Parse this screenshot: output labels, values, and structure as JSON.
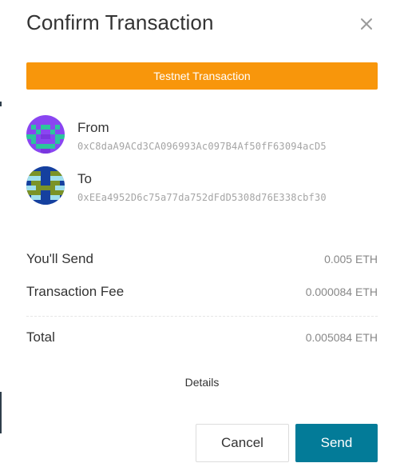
{
  "dialog": {
    "title": "Confirm Transaction",
    "close_icon": "close-icon"
  },
  "banner": {
    "text": "Testnet Transaction",
    "color": "#f8960b"
  },
  "from": {
    "label": "From",
    "address": "0xC8daA9ACd3CA096993Ac097B4Af50fF63094acD5",
    "avatar_icon": "identicon-avatar",
    "avatar_colors": [
      "#8a45f1",
      "#2bc69c"
    ]
  },
  "to": {
    "label": "To",
    "address": "0xEEa4952D6c75a77da752dFdD5308d76E338cbf30",
    "avatar_icon": "identicon-avatar",
    "avatar_colors": [
      "#15409f",
      "#7b9327",
      "#9fe0ee"
    ]
  },
  "summary": {
    "send_label": "You'll Send",
    "send_value": "0.005 ETH",
    "fee_label": "Transaction Fee",
    "fee_value": "0.000084 ETH",
    "total_label": "Total",
    "total_value": "0.005084 ETH"
  },
  "details_label": "Details",
  "actions": {
    "cancel_label": "Cancel",
    "send_label": "Send",
    "primary_color": "#037b98"
  }
}
